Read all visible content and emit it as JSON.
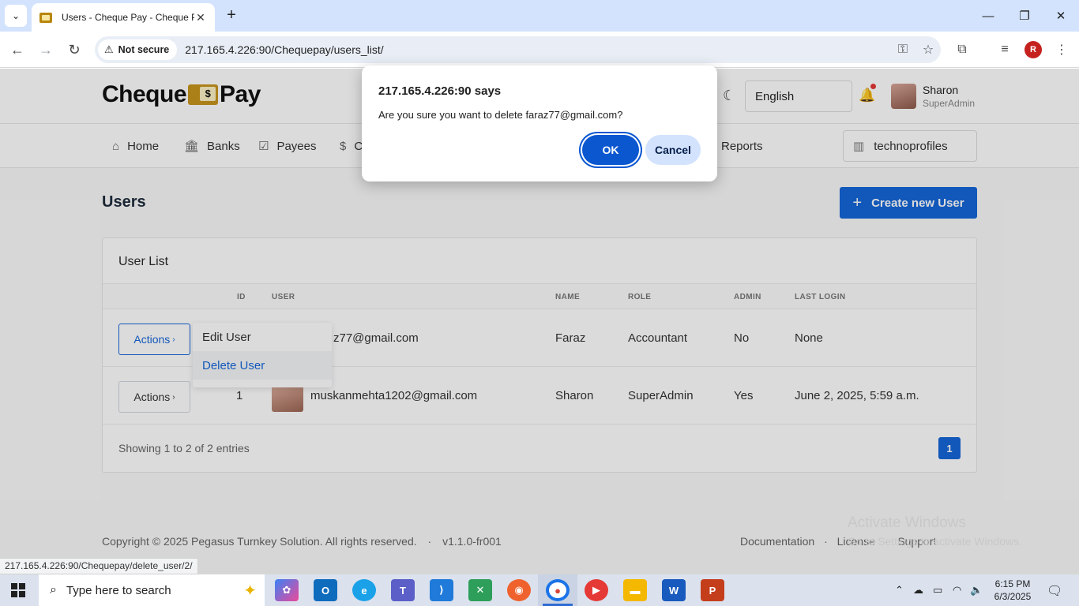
{
  "browser": {
    "tab_title": "Users - Cheque Pay - Cheque P",
    "address_chip": "Not secure",
    "url": "217.165.4.226:90/Chequepay/users_list/",
    "profile_initial": "R",
    "status_url": "217.165.4.226:90/Chequepay/delete_user/2/"
  },
  "header": {
    "logo_left": "Cheque",
    "logo_right": "Pay",
    "language": "English",
    "user_name": "Sharon",
    "user_role": "SuperAdmin"
  },
  "nav": {
    "items": [
      {
        "label": "Home",
        "icon": "home-icon"
      },
      {
        "label": "Banks",
        "icon": "bank-icon"
      },
      {
        "label": "Payees",
        "icon": "payees-icon"
      },
      {
        "label": "C",
        "icon": "dollar-icon"
      },
      {
        "label": "Reports",
        "icon": "reports-icon"
      }
    ],
    "organization": "technoprofiles"
  },
  "page": {
    "title": "Users",
    "create_button": "Create new User"
  },
  "table": {
    "card_title": "User List",
    "columns": [
      "ID",
      "USER",
      "NAME",
      "ROLE",
      "ADMIN",
      "LAST LOGIN"
    ],
    "rows": [
      {
        "id": "",
        "user": "z77@gmail.com",
        "name": "Faraz",
        "role": "Accountant",
        "admin": "No",
        "last_login": "None"
      },
      {
        "id": "1",
        "user": "muskanmehta1202@gmail.com",
        "name": "Sharon",
        "role": "SuperAdmin",
        "admin": "Yes",
        "last_login": "June 2, 2025, 5:59 a.m."
      }
    ],
    "actions_label": "Actions",
    "showing": "Showing 1 to 2 of 2 entries",
    "page": "1"
  },
  "dropdown": {
    "items": [
      "Edit User",
      "Delete User"
    ]
  },
  "footer": {
    "copyright": "Copyright © 2025 Pegasus Turnkey Solution. All rights reserved.",
    "separator": "·",
    "version": "v1.1.0-fr001",
    "documentation": "Documentation",
    "license": "License",
    "support": "Support"
  },
  "dialog": {
    "title": "217.165.4.226:90 says",
    "message": "Are you sure you want to delete faraz77@gmail.com?",
    "ok": "OK",
    "cancel": "Cancel"
  },
  "watermark": {
    "line1": "Activate Windows",
    "line2": "Go to Settings to activate Windows."
  },
  "taskbar": {
    "search_placeholder": "Type here to search",
    "time": "6:15 PM",
    "date": "6/3/2025"
  }
}
